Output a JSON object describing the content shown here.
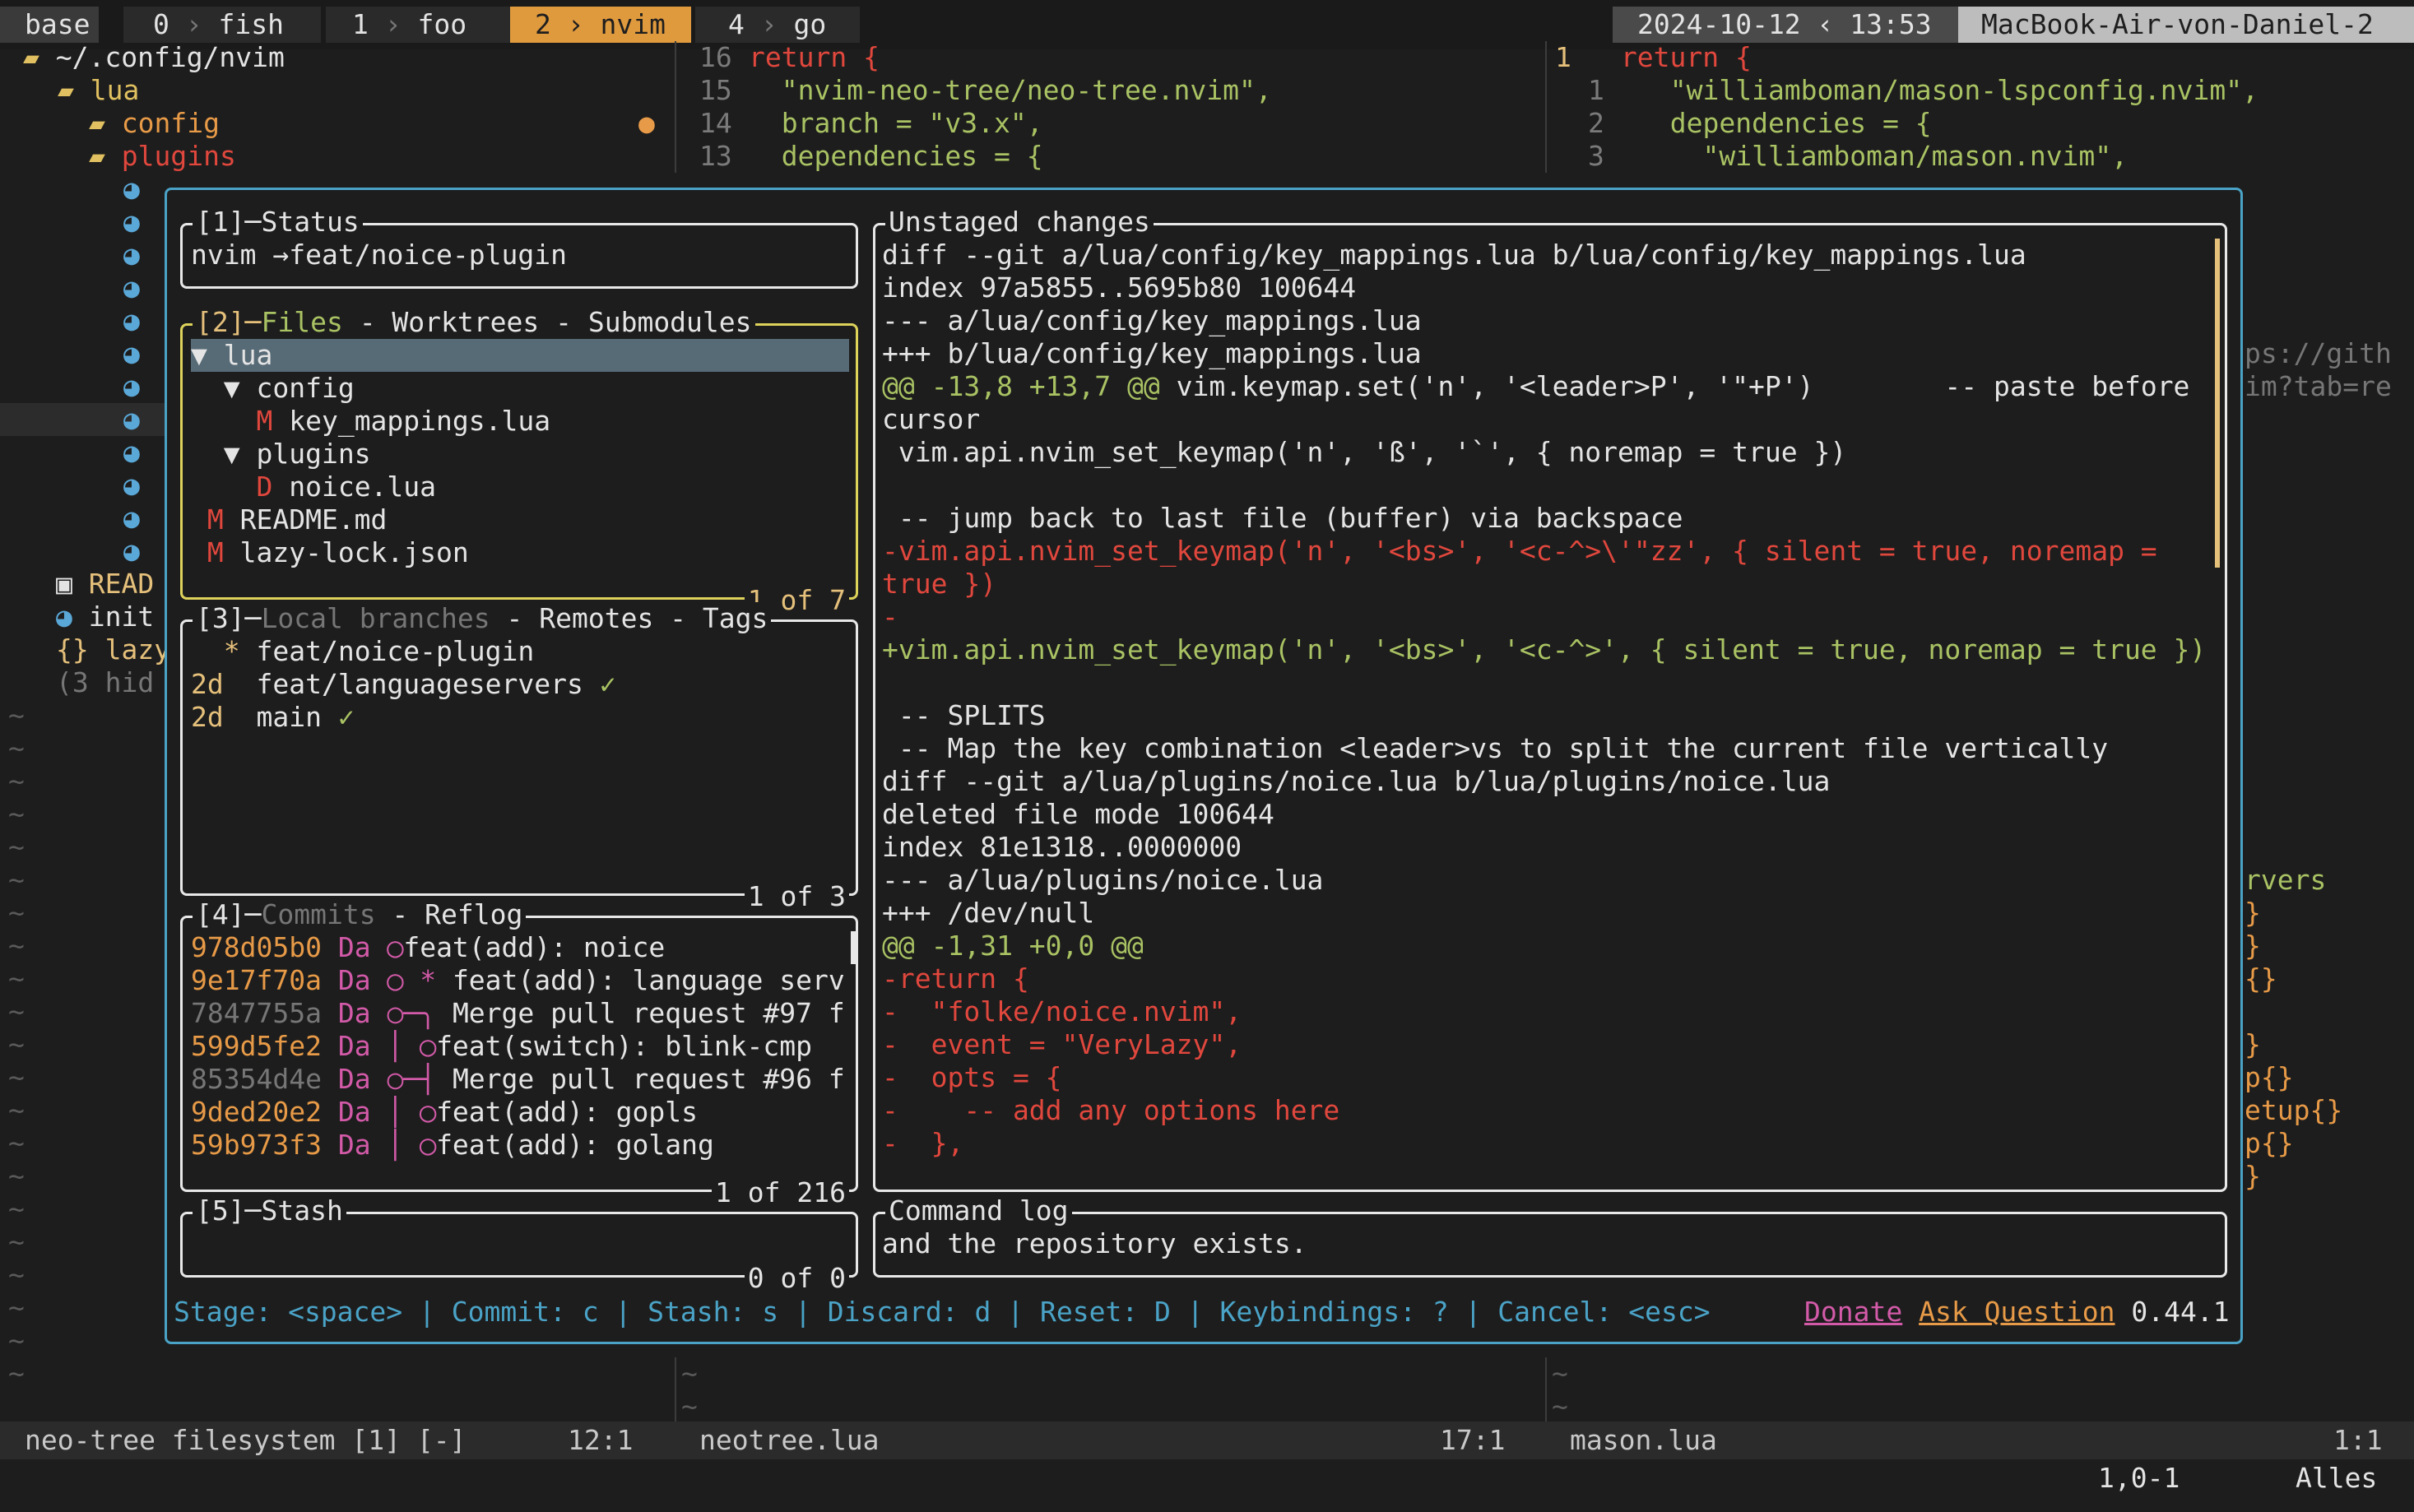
{
  "tmux": {
    "session": "base",
    "windows": [
      {
        "index": "0",
        "name": "fish"
      },
      {
        "index": "1",
        "name": "foo"
      },
      {
        "index": "2",
        "name": "nvim"
      },
      {
        "index": "4",
        "name": "go"
      }
    ],
    "date": "2024-10-12",
    "time": "13:53",
    "host": "MacBook-Air-von-Daniel-2"
  },
  "neotree": {
    "root": "~/.config/nvim",
    "lua": "lua",
    "config": "config",
    "plugins": "plugins",
    "readme": "READ",
    "init": "init",
    "lazy": "lazy",
    "hidden": "(3 hid"
  },
  "editor_mid": {
    "lines": [
      {
        "nr": "16",
        "text": "return {"
      },
      {
        "nr": "15",
        "text": "  \"nvim-neo-tree/neo-tree.nvim\","
      },
      {
        "nr": "14",
        "text": "  branch = \"v3.x\","
      },
      {
        "nr": "13",
        "text": "  dependencies = {"
      }
    ]
  },
  "editor_right": {
    "lines": [
      {
        "nr": "1",
        "text": " return {"
      },
      {
        "nr": "1",
        "text": "  \"williamboman/mason-lspconfig.nvim\","
      },
      {
        "nr": "2",
        "text": "  dependencies = {"
      },
      {
        "nr": "3",
        "text": "    \"williamboman/mason.nvim\","
      }
    ],
    "peek": [
      "ps://gith",
      "im?tab=re",
      "rvers",
      "}",
      "}",
      "{}",
      "}",
      "p{}",
      "etup{}",
      "p{}",
      "}"
    ]
  },
  "lazygit": {
    "status": {
      "title": "[1]─Status",
      "repo": "nvim",
      "arrow": "→",
      "branch": "feat/noice-plugin"
    },
    "files": {
      "title_num": "[2]─",
      "title_active": "Files",
      "title_rest": " - Worktrees - Submodules",
      "footer": "1 of 7",
      "items": [
        {
          "prefix": "▼ ",
          "name": "lua"
        },
        {
          "prefix": "  ▼ ",
          "name": "config"
        },
        {
          "prefix": "    M ",
          "name": "key_mappings.lua"
        },
        {
          "prefix": "  ▼ ",
          "name": "plugins"
        },
        {
          "prefix": "    D ",
          "name": "noice.lua"
        },
        {
          "prefix": " M ",
          "name": "README.md"
        },
        {
          "prefix": " M ",
          "name": "lazy-lock.json"
        }
      ]
    },
    "branches": {
      "title_num": "[3]─",
      "title_active": "Local branches",
      "title_rest": " - Remotes - Tags",
      "footer": "1 of 3",
      "items": [
        {
          "age": "  *",
          "name": "feat/noice-plugin",
          "check": ""
        },
        {
          "age": "2d",
          "name": "feat/languageservers",
          "check": "✓"
        },
        {
          "age": "2d",
          "name": "main",
          "check": "✓"
        }
      ]
    },
    "commits": {
      "title_num": "[4]─",
      "title_active": "Commits",
      "title_rest": " - Reflog",
      "footer": "1 of 216",
      "items": [
        {
          "hash": "978d05b0",
          "author": "Da",
          "graph": "◯",
          "msg": "feat(add): noice"
        },
        {
          "hash": "9e17f70a",
          "author": "Da",
          "graph": "◯ *",
          "msg": "feat(add): language serv"
        },
        {
          "hash": "7847755a",
          "author": "Da",
          "graph": "○─╮ ",
          "msg": "Merge pull request #97 f"
        },
        {
          "hash": "599d5fe2",
          "author": "Da",
          "graph": "│ ◯",
          "msg": "feat(switch): blink-cmp"
        },
        {
          "hash": "85354d4e",
          "author": "Da",
          "graph": "○─┤ ",
          "msg": "Merge pull request #96 f"
        },
        {
          "hash": "9ded20e2",
          "author": "Da",
          "graph": "│ ◯",
          "msg": "feat(add): gopls"
        },
        {
          "hash": "59b973f3",
          "author": "Da",
          "graph": "│ ◯",
          "msg": "feat(add): golang"
        }
      ]
    },
    "stash": {
      "title": "[5]─Stash",
      "footer": "0 of 0"
    },
    "diff": {
      "title": "Unstaged changes",
      "lines": [
        {
          "kind": "plain",
          "text": "diff --git a/lua/config/key_mappings.lua b/lua/config/key_mappings.lua"
        },
        {
          "kind": "plain",
          "text": "index 97a5855..5695b80 100644"
        },
        {
          "kind": "plain",
          "text": "--- a/lua/config/key_mappings.lua"
        },
        {
          "kind": "plain",
          "text": "+++ b/lua/config/key_mappings.lua"
        },
        {
          "kind": "hunk",
          "text": "@@ -13,8 +13,7 @@",
          "rest": " vim.keymap.set('n', '<leader>P', '\"+P')        -- paste before"
        },
        {
          "kind": "plain",
          "text": "cursor"
        },
        {
          "kind": "plain",
          "text": " vim.api.nvim_set_keymap('n', 'ß', '`', { noremap = true })"
        },
        {
          "kind": "plain",
          "text": ""
        },
        {
          "kind": "plain",
          "text": " -- jump back to last file (buffer) via backspace"
        },
        {
          "kind": "del",
          "text": "-vim.api.nvim_set_keymap('n', '<bs>', '<c-^>\\'\"zz', { silent = true, noremap ="
        },
        {
          "kind": "del",
          "text": "true })"
        },
        {
          "kind": "del",
          "text": "-"
        },
        {
          "kind": "add",
          "text": "+vim.api.nvim_set_keymap('n', '<bs>', '<c-^>', { silent = true, noremap = true })"
        },
        {
          "kind": "plain",
          "text": ""
        },
        {
          "kind": "plain",
          "text": " -- SPLITS"
        },
        {
          "kind": "plain",
          "text": " -- Map the key combination <leader>vs to split the current file vertically"
        },
        {
          "kind": "plain",
          "text": "diff --git a/lua/plugins/noice.lua b/lua/plugins/noice.lua"
        },
        {
          "kind": "plain",
          "text": "deleted file mode 100644"
        },
        {
          "kind": "plain",
          "text": "index 81e1318..0000000"
        },
        {
          "kind": "plain",
          "text": "--- a/lua/plugins/noice.lua"
        },
        {
          "kind": "plain",
          "text": "+++ /dev/null"
        },
        {
          "kind": "hunk",
          "text": "@@ -1,31 +0,0 @@",
          "rest": ""
        },
        {
          "kind": "del",
          "text": "-return {"
        },
        {
          "kind": "del",
          "text": "-  \"folke/noice.nvim\","
        },
        {
          "kind": "del",
          "text": "-  event = \"VeryLazy\","
        },
        {
          "kind": "del",
          "text": "-  opts = {"
        },
        {
          "kind": "del",
          "text": "-    -- add any options here"
        },
        {
          "kind": "del",
          "text": "-  },"
        }
      ]
    },
    "command_log": {
      "title": "Command log",
      "text": "and the repository exists."
    },
    "footer": {
      "keys": "Stage: <space> | Commit: c | Stash: s | Discard: d | Reset: D | Keybindings: ? | Cancel: <esc>",
      "donate": "Donate",
      "ask": "Ask Question",
      "version": "0.44.1"
    }
  },
  "statusline": {
    "left": "neo-tree filesystem [1] [-]",
    "left_pos": "12:1",
    "mid": "neotree.lua",
    "mid_pos": "17:1",
    "right": "mason.lua",
    "right_pos": "1:1"
  },
  "cmdline": {
    "pos": "1,0-1",
    "scroll": "Alles"
  }
}
